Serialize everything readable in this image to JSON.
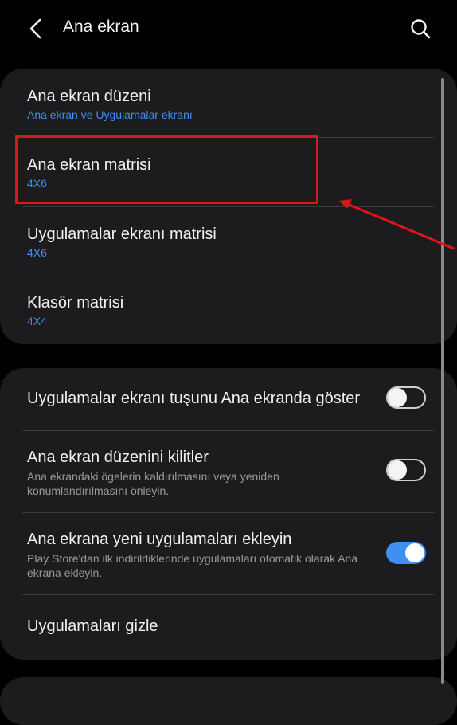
{
  "header": {
    "title": "Ana ekran",
    "back_icon": "back-arrow-icon",
    "search_icon": "search-icon"
  },
  "section1": {
    "items": [
      {
        "label": "Ana ekran düzeni",
        "value": "Ana ekran ve Uygulamalar ekranı"
      },
      {
        "label": "Ana ekran matrisi",
        "value": "4X6"
      },
      {
        "label": "Uygulamalar ekranı matrisi",
        "value": "4X6"
      },
      {
        "label": "Klasör matrisi",
        "value": "4X4"
      }
    ]
  },
  "section2": {
    "items": [
      {
        "label": "Uygulamalar ekranı tuşunu Ana ekranda göster",
        "toggle": false
      },
      {
        "label": "Ana ekran düzenini kilitler",
        "description": "Ana ekrandaki ögelerin kaldırılmasını veya yeniden konumlandırılmasını önleyin.",
        "toggle": false
      },
      {
        "label": "Ana ekrana yeni uygulamaları ekleyin",
        "description": "Play Store'dan ilk indirildiklerinde uygulamaları otomatik olarak Ana ekrana ekleyin.",
        "toggle": true
      },
      {
        "label": "Uygulamaları gizle"
      }
    ]
  },
  "colors": {
    "background": "#000000",
    "card": "#1c1c1e",
    "accent": "#3e91f3",
    "annotation": "#e0141b"
  }
}
